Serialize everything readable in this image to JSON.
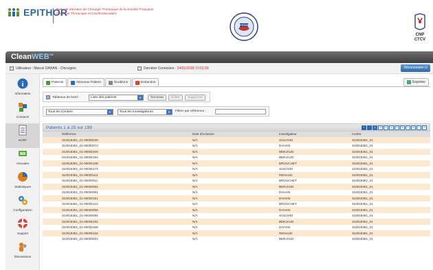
{
  "header": {
    "brand": "EPITHOR",
    "tagline_line1": "Base de données de Chirurgie Thoracique de la Société Française",
    "tagline_line2": "Chirurgie Thoracique et CardioVasculaire",
    "logo_cnp_line1": "CNP",
    "logo_cnp_line2": "CTCV",
    "seal_text": "EPITHOR"
  },
  "appbar": {
    "name_part1": "Clean",
    "name_part2": "WEB",
    "tm": "TM"
  },
  "userbar": {
    "user_label": "Utilisateur : Marcel DAHAN - Chirurgien",
    "last_connection_label": "Dernière Connexion :",
    "last_connection_value": "24/01/2018 10:52:09",
    "logout_label": "Déconnexion"
  },
  "sidebar": {
    "items": [
      {
        "label": "Information",
        "icon": "info-icon"
      },
      {
        "label": "Contacts",
        "icon": "contacts-icon"
      },
      {
        "label": "eCRF",
        "icon": "ecrf-icon"
      },
      {
        "label": "Annuaire",
        "icon": "directory-icon"
      },
      {
        "label": "Statistiques",
        "icon": "chart-icon"
      },
      {
        "label": "Configuration",
        "icon": "gears-icon"
      },
      {
        "label": "Support",
        "icon": "lifebuoy-icon"
      },
      {
        "label": "Discussions",
        "icon": "chat-icon"
      }
    ]
  },
  "tabs": [
    "Patients",
    "Nouveau Patient",
    "Doublons",
    "Extraction"
  ],
  "export_label": "Exporter",
  "dashboard": {
    "label": "Tableaux de bord :",
    "selected": "Liste des patients",
    "new_label": "Nouveau",
    "edit_label": "Editer",
    "delete_label": "Supprimer"
  },
  "filters": {
    "centres": "Tous les Centres",
    "investigators": "Tous les Investigateurs",
    "ref_label": "Filtrer par référence :",
    "ref_value": ""
  },
  "table": {
    "title": "Patients 1 à 25 sur 199",
    "pages": [
      "1",
      "2",
      "3",
      "4",
      "5",
      "6",
      "7",
      "8"
    ],
    "columns": [
      "Référence",
      "Date d'inclusion",
      "Investigateur",
      "Centre"
    ],
    "rows": [
      [
        "310019351_01-00000030",
        "N/A",
        "SOLOVEI",
        "310019351_01"
      ],
      [
        "310019351_01-00000072",
        "N/A",
        "DAHAN",
        "310019351_01"
      ],
      [
        "310019351_01-00000100",
        "N/A",
        "BERJAUD",
        "310019351_01"
      ],
      [
        "310019351_01-00000194",
        "N/A",
        "BERJAUD",
        "310019351_01"
      ],
      [
        "310019351_01-00000138",
        "N/A",
        "BROUCHET",
        "310019351_01"
      ],
      [
        "310019351_01-00000174",
        "N/A",
        "SOLOVEI",
        "310019351_01"
      ],
      [
        "310019351_01-00000113",
        "N/A",
        "RENAUD",
        "310019351_01"
      ],
      [
        "310019351_01-00000011",
        "N/A",
        "BROUCHET",
        "310019351_01"
      ],
      [
        "310019351_01-00000052",
        "N/A",
        "BERJAUD",
        "310019351_01"
      ],
      [
        "310019351_01-00000081",
        "N/A",
        "DAHAN",
        "310019351_01"
      ],
      [
        "310019351_01-00000151",
        "N/A",
        "DAHAN",
        "310019351_01"
      ],
      [
        "310019351_01-00000122",
        "N/A",
        "BROUCHET",
        "310019351_01"
      ],
      [
        "310019351_01-00000065",
        "N/A",
        "DAHAN",
        "310019351_01"
      ],
      [
        "310019351_01-00000094",
        "N/A",
        "SOLOVEI",
        "310019351_01"
      ],
      [
        "310019351_01-00000184",
        "N/A",
        "BERJAUD",
        "310019351_01"
      ],
      [
        "310019351_01-00000168",
        "N/A",
        "DAHAN",
        "310019351_01"
      ],
      [
        "310019351_01-00000132",
        "N/A",
        "RENAUD",
        "310019351_01"
      ],
      [
        "310019351_01-00000024",
        "N/A",
        "BERJAUD",
        "310019351_01"
      ]
    ]
  },
  "colors": {
    "accent": "#2d6fb7",
    "row_alt": "#fce9cf",
    "brand": "#2c68a6",
    "alert": "#dd2222"
  }
}
